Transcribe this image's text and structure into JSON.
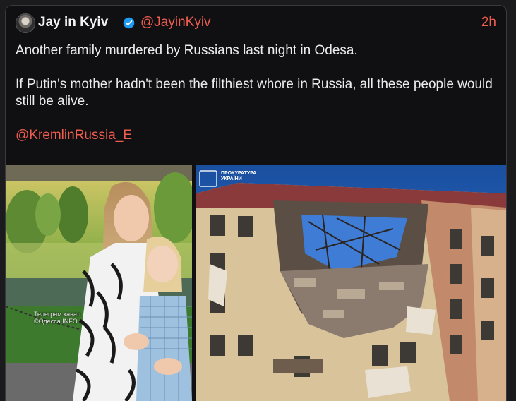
{
  "post": {
    "author_name": "Jay in Kyiv",
    "handle": "@JayinKyiv",
    "time_ago": "2h",
    "paragraph1": "Another family murdered by Russians last night in Odesa.",
    "paragraph2": "If Putin's mother hadn't been the filthiest whore in Russia, all these people would still be alive.",
    "mention": "@KremlinRussia_E"
  },
  "media": {
    "left_watermark_line1": "Телеграм канал",
    "left_watermark_line2": "©Одесса INFO",
    "right_emblem_line1": "ПРОКУРАТУРА",
    "right_emblem_line2": "УКРАЇНИ"
  },
  "colors": {
    "accent": "#ef5d4f",
    "verified": "#1d9bf0",
    "text": "#ececec",
    "card_bg": "#101012"
  },
  "icons": {
    "verified": "verified-badge-icon",
    "avatar": "profile-avatar"
  }
}
